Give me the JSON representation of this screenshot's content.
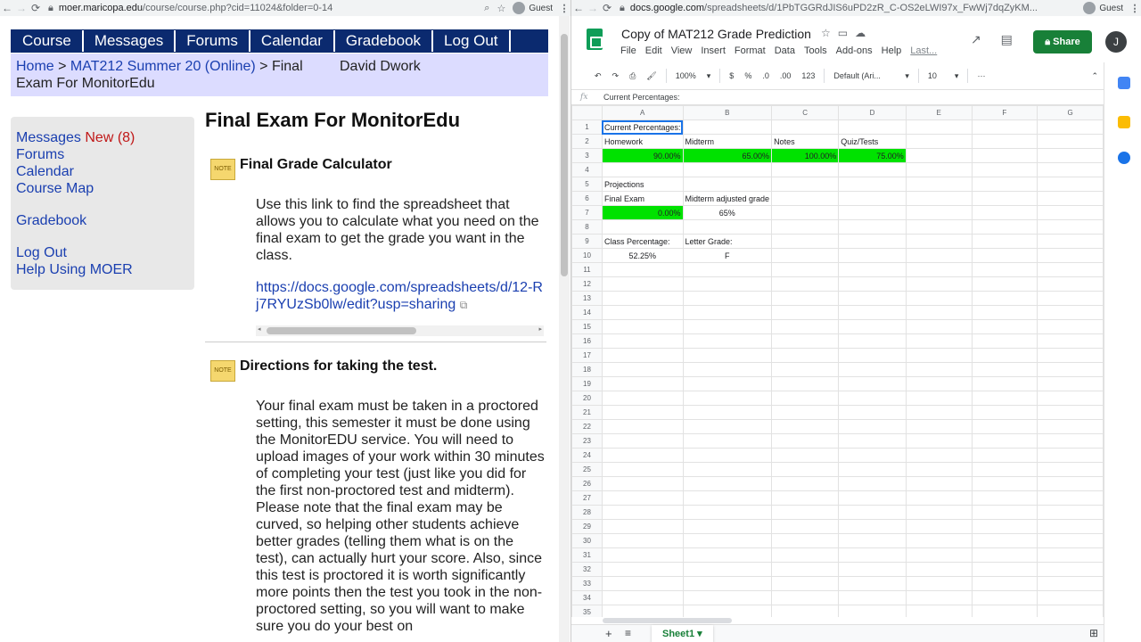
{
  "left_browser": {
    "url_host": "moer.maricopa.edu",
    "url_path": "/course/course.php?cid=11024&folder=0-14",
    "profile": "Guest"
  },
  "moer": {
    "nav": [
      "Course",
      "Messages",
      "Forums",
      "Calendar",
      "Gradebook",
      "Log Out"
    ],
    "breadcrumb": {
      "home": "Home",
      "sep1": " > ",
      "course": "MAT212 Summer 20 (Online)",
      "sep2": " > ",
      "page_line1": "Final",
      "page_line2": "Exam For MonitorEdu"
    },
    "user_name": "David Dwork",
    "sidebar": {
      "messages": "Messages",
      "new_label": "New (8)",
      "forums": "Forums",
      "calendar": "Calendar",
      "course_map": "Course Map",
      "gradebook": "Gradebook",
      "logout": "Log Out",
      "help": "Help Using MOER"
    },
    "page_title": "Final Exam For MonitorEdu",
    "note_label": "NOTE",
    "section1": {
      "title": "Final Grade Calculator",
      "body": "Use this link to find the spreadsheet that allows you to calculate what you need on the final exam to get the grade you want in the class.",
      "link": "https://docs.google.com/spreadsheets/d/12-Rj7RYUzSb0lw/edit?usp=sharing"
    },
    "section2": {
      "title": "Directions for taking the test.",
      "body": "Your final exam must be taken in a proctored setting, this semester it must be done using the MonitorEDU service.  You will need to upload images of your work within 30 minutes of completing your test (just like you did for the first non-proctored test and midterm). Please note that the final exam may be curved, so helping other students achieve better grades (telling them what is on the test), can actually hurt your score. Also, since this test is proctored it is worth significantly more points then the test you took in the non-proctored setting, so you will want to make sure you do your best on"
    }
  },
  "right_browser": {
    "url_host": "docs.google.com",
    "url_path": "/spreadsheets/d/1PbTGGRdJIS6uPD2zR_C-OS2eLWI97x_FwWj7dqZyKM...",
    "profile": "Guest"
  },
  "sheets": {
    "doc_title": "Copy of MAT212 Grade Prediction",
    "menu": [
      "File",
      "Edit",
      "View",
      "Insert",
      "Format",
      "Data",
      "Tools",
      "Add-ons",
      "Help"
    ],
    "last_edit": "Last...",
    "share_label": "Share",
    "user_initial": "J",
    "toolbar": {
      "zoom": "100%",
      "currency": "$",
      "percent": "%",
      "dec_less": ".0",
      "dec_more": ".00",
      "format_more": "123",
      "font": "Default (Ari...",
      "size": "10",
      "more": "···"
    },
    "formula_bar_value": "Current Percentages:",
    "columns": [
      "A",
      "B",
      "C",
      "D",
      "E",
      "F",
      "G"
    ],
    "cells": {
      "A1": "Current Percentages:",
      "A2": "Homework",
      "B2": "Midterm",
      "C2": "Notes",
      "D2": "Quiz/Tests",
      "A3": "90.00%",
      "B3": "65.00%",
      "C3": "100.00%",
      "D3": "75.00%",
      "A5": "Projections",
      "A6": "Final Exam",
      "B6": "Midterm adjusted grade",
      "A7": "0.00%",
      "B7": "65%",
      "A9": "Class Percentage:",
      "B9": "Letter Grade:",
      "A10": "52.25%",
      "B10": "F"
    },
    "row_count_visible": 36,
    "sheet_tab": "Sheet1",
    "highlight_color": "#00e200",
    "accent_green": "#188038",
    "selection_color": "#1a73e8"
  }
}
